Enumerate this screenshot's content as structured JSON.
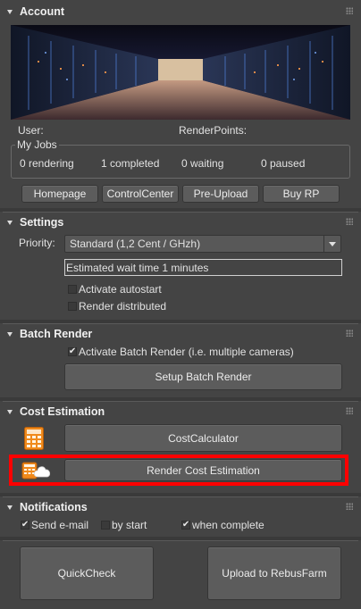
{
  "account": {
    "title": "Account",
    "user_label": "User:",
    "renderpoints_label": "RenderPoints:",
    "jobs_group_label": "My Jobs",
    "jobs": [
      "0 rendering",
      "1 completed",
      "0 waiting",
      "0 paused"
    ],
    "buttons": [
      "Homepage",
      "ControlCenter",
      "Pre-Upload",
      "Buy RP"
    ]
  },
  "settings": {
    "title": "Settings",
    "priority_label": "Priority:",
    "priority_value": "Standard (1,2 Cent / GHzh)",
    "wait_text": "Estimated wait time 1 minutes",
    "activate_autostart": {
      "label": "Activate autostart",
      "checked": false
    },
    "render_distributed": {
      "label": "Render distributed",
      "checked": false
    }
  },
  "batch": {
    "title": "Batch Render",
    "activate": {
      "label": "Activate Batch Render (i.e. multiple cameras)",
      "checked": true
    },
    "setup_button": "Setup Batch Render"
  },
  "cost": {
    "title": "Cost Estimation",
    "calculator_button": "CostCalculator",
    "render_cost_button": "Render Cost Estimation",
    "highlight_color": "#ff0000"
  },
  "notifications": {
    "title": "Notifications",
    "send_email": {
      "label": "Send e-mail",
      "checked": true
    },
    "by_start": {
      "label": "by start",
      "checked": false
    },
    "when_complete": {
      "label": "when complete",
      "checked": true
    }
  },
  "footer": {
    "quickcheck": "QuickCheck",
    "upload": "Upload to RebusFarm"
  },
  "icons": {
    "calculator": "calculator-icon",
    "cloud_calculator": "cloud-calculator-icon",
    "dropdown": "chevron-down-icon"
  }
}
